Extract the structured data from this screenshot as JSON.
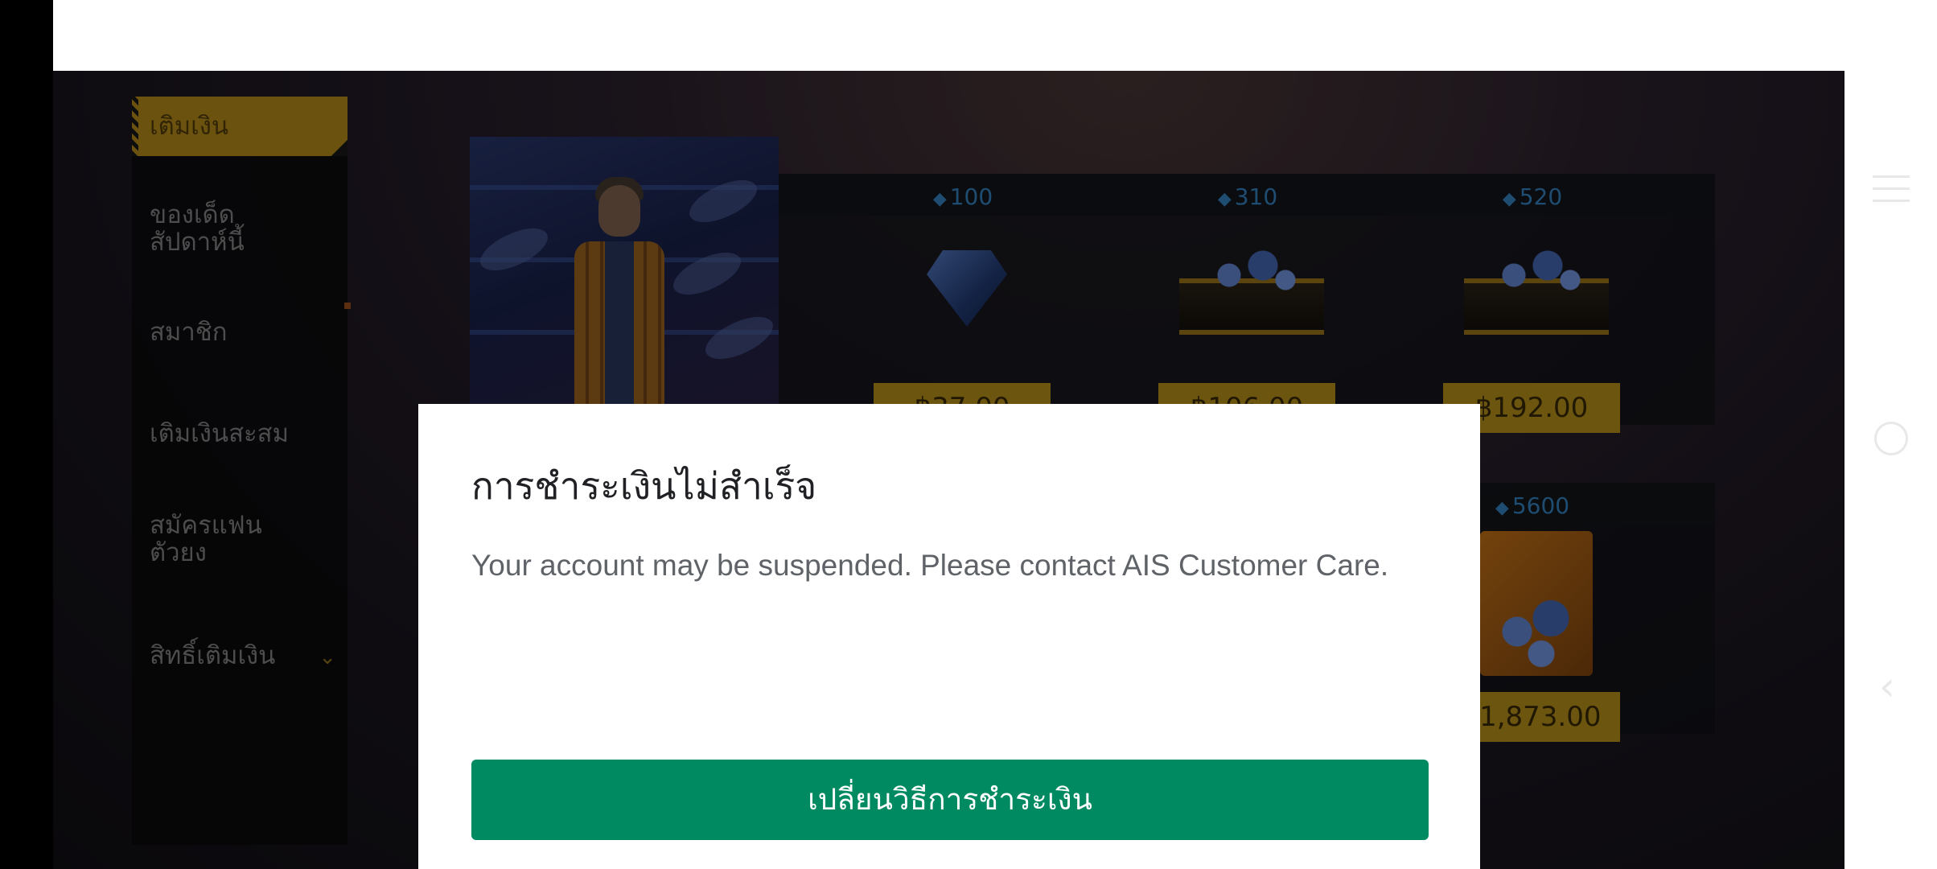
{
  "sidebar": {
    "items": [
      {
        "label": "เติมเงิน",
        "active": true
      },
      {
        "label": "ของเด็ดสัปดาห์นี้"
      },
      {
        "label": "สมาชิก"
      },
      {
        "label": "เติมเงินสะสม"
      },
      {
        "label": "สมัครแฟนตัวยง"
      },
      {
        "label": "สิทธิ์เติมเงิน",
        "icon": "chevron-down-icon"
      }
    ]
  },
  "shop": {
    "row1": [
      {
        "count": "100",
        "price": "฿37.00",
        "icon": "diamond-icon"
      },
      {
        "count": "310",
        "price": "฿106.00",
        "icon": "diamond-icon"
      },
      {
        "count": "520",
        "price": "฿192.00",
        "icon": "diamond-icon"
      }
    ],
    "row2": [
      {
        "count": "5600",
        "price": "฿1,873.00",
        "icon": "diamond-icon"
      }
    ]
  },
  "dialog": {
    "title": "การชำระเงินไม่สำเร็จ",
    "message": "Your account may be suspended. Please contact AIS Customer Care.",
    "button": "เปลี่ยนวิธีการชำระเงิน"
  },
  "colors": {
    "accent_gold": "#c59b1a",
    "button_green": "#008a61",
    "gem_blue": "#3a8ccf"
  }
}
